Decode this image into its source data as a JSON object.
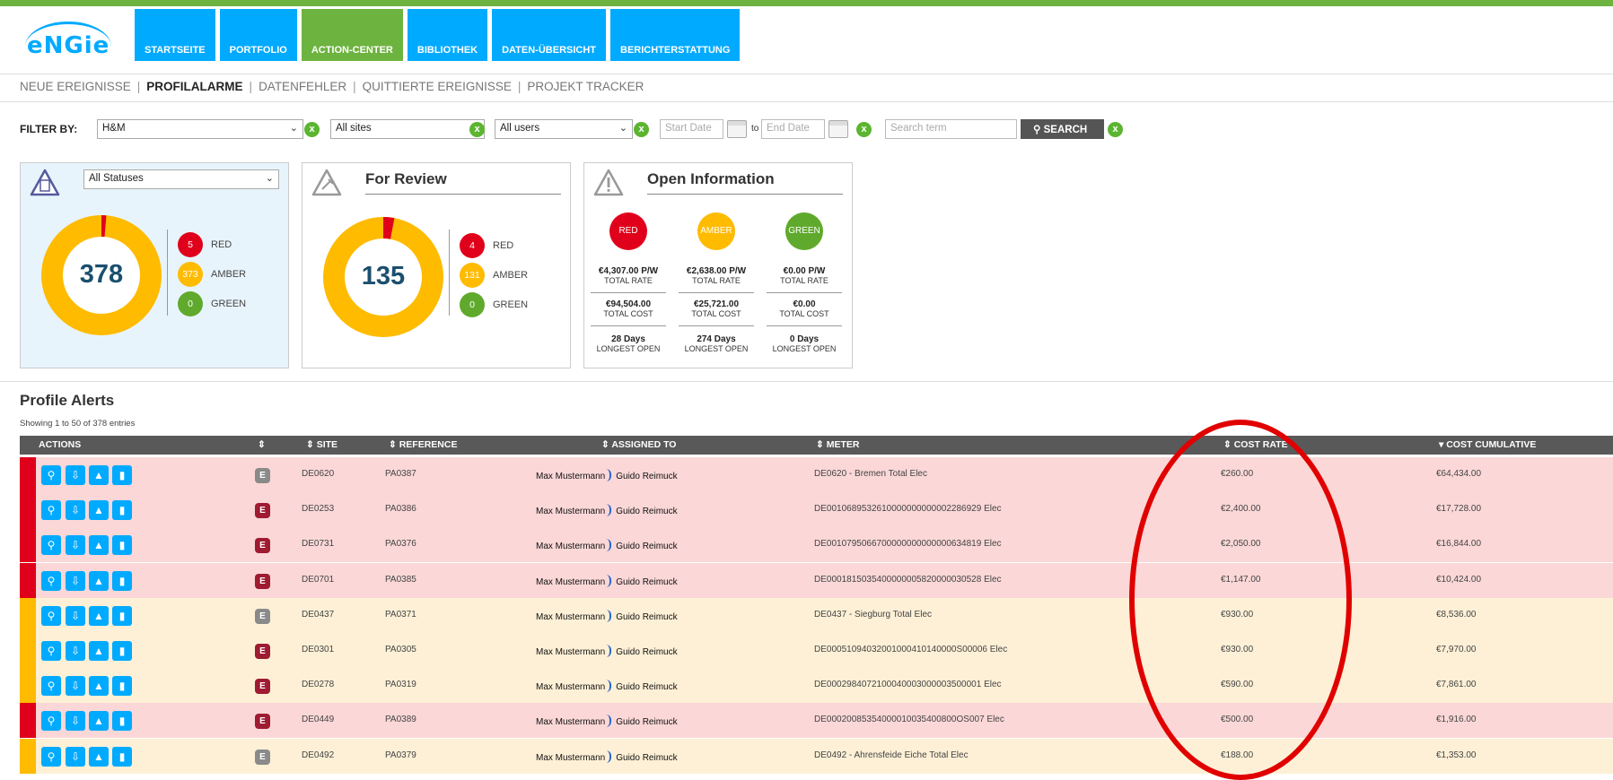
{
  "brand": {
    "logo_text": "eNGie",
    "accent": "#00aaff",
    "green": "#6db33f"
  },
  "nav": {
    "tabs": [
      {
        "label": "STARTSEITE",
        "active": false
      },
      {
        "label": "PORTFOLIO",
        "active": false
      },
      {
        "label": "ACTION-CENTER",
        "active": true
      },
      {
        "label": "BIBLIOTHEK",
        "active": false
      },
      {
        "label": "DATEN-ÜBERSICHT",
        "active": false
      },
      {
        "label": "BERICHTERSTATTUNG",
        "active": false
      }
    ]
  },
  "subnav": {
    "items": [
      {
        "label": "NEUE EREIGNISSE",
        "active": false
      },
      {
        "label": "PROFILALARME",
        "active": true
      },
      {
        "label": "DATENFEHLER",
        "active": false
      },
      {
        "label": "QUITTIERTE EREIGNISSE",
        "active": false
      },
      {
        "label": "PROJEKT TRACKER",
        "active": false
      }
    ]
  },
  "filter": {
    "label": "FILTER BY:",
    "client": "H&M",
    "sites": "All sites",
    "users": "All users",
    "start_placeholder": "Start Date",
    "to_label": "to",
    "end_placeholder": "End Date",
    "search_placeholder": "Search term",
    "search_button": "SEARCH",
    "clear_label": "x"
  },
  "cards": {
    "status": {
      "select": "All Statuses",
      "total": "378",
      "legend": [
        {
          "count": "5",
          "label": "RED",
          "color": "#e0001b"
        },
        {
          "count": "373",
          "label": "AMBER",
          "color": "#ffbb00"
        },
        {
          "count": "0",
          "label": "GREEN",
          "color": "#5faa2c"
        }
      ]
    },
    "review": {
      "title": "For Review",
      "total": "135",
      "legend": [
        {
          "count": "4",
          "label": "RED",
          "color": "#e0001b"
        },
        {
          "count": "131",
          "label": "AMBER",
          "color": "#ffbb00"
        },
        {
          "count": "0",
          "label": "GREEN",
          "color": "#5faa2c"
        }
      ]
    },
    "open": {
      "title": "Open Information",
      "columns": [
        {
          "label": "RED",
          "color": "#e0001b",
          "rate": "€4,307.00 P/W",
          "rate_lbl": "TOTAL RATE",
          "cost": "€94,504.00",
          "cost_lbl": "TOTAL COST",
          "days": "28 Days",
          "days_lbl": "LONGEST OPEN"
        },
        {
          "label": "AMBER",
          "color": "#ffbb00",
          "rate": "€2,638.00 P/W",
          "rate_lbl": "TOTAL RATE",
          "cost": "€25,721.00",
          "cost_lbl": "TOTAL COST",
          "days": "274 Days",
          "days_lbl": "LONGEST OPEN"
        },
        {
          "label": "GREEN",
          "color": "#5faa2c",
          "rate": "€0.00 P/W",
          "rate_lbl": "TOTAL RATE",
          "cost": "€0.00",
          "cost_lbl": "TOTAL COST",
          "days": "0 Days",
          "days_lbl": "LONGEST OPEN"
        }
      ]
    }
  },
  "table": {
    "title": "Profile Alerts",
    "showing": "Showing 1 to 50 of 378 entries",
    "headers": {
      "actions": "ACTIONS",
      "type": "⇕",
      "site": "⇕ SITE",
      "reference": "⇕ REFERENCE",
      "assigned": "⇕ ASSIGNED TO",
      "meter": "⇕ METER",
      "cost_rate": "⇕ COST RATE",
      "cost_cumulative": "▾ COST CUMULATIVE"
    },
    "rows": [
      {
        "status": "red",
        "icon": "E",
        "icon_style": "grey",
        "site": "DE0620",
        "ref": "PA0387",
        "from": "Max Mustermann",
        "to": "Guido Reimuck",
        "meter": "DE0620 - Bremen Total Elec",
        "rate": "€260.00",
        "cum": "€64,434.00"
      },
      {
        "status": "red",
        "icon": "E",
        "icon_style": "red",
        "site": "DE0253",
        "ref": "PA0386",
        "from": "Max Mustermann",
        "to": "Guido Reimuck",
        "meter": "DE0010689532610000000000002286929 Elec",
        "rate": "€2,400.00",
        "cum": "€17,728.00"
      },
      {
        "status": "red",
        "icon": "E",
        "icon_style": "red",
        "site": "DE0731",
        "ref": "PA0376",
        "from": "Max Mustermann",
        "to": "Guido Reimuck",
        "meter": "DE0010795066700000000000000634819 Elec",
        "rate": "€2,050.00",
        "cum": "€16,844.00"
      },
      {
        "status": "red",
        "icon": "E",
        "icon_style": "red",
        "site": "DE0701",
        "ref": "PA0385",
        "from": "Max Mustermann",
        "to": "Guido Reimuck",
        "meter": "DE0001815035400000005820000030528 Elec",
        "rate": "€1,147.00",
        "cum": "€10,424.00"
      },
      {
        "status": "amber",
        "icon": "E",
        "icon_style": "grey",
        "site": "DE0437",
        "ref": "PA0371",
        "from": "Max Mustermann",
        "to": "Guido Reimuck",
        "meter": "DE0437 - Siegburg Total Elec",
        "rate": "€930.00",
        "cum": "€8,536.00"
      },
      {
        "status": "amber",
        "icon": "E",
        "icon_style": "red",
        "site": "DE0301",
        "ref": "PA0305",
        "from": "Max Mustermann",
        "to": "Guido Reimuck",
        "meter": "DE00051094032001000410140000S00006 Elec",
        "rate": "€930.00",
        "cum": "€7,970.00"
      },
      {
        "status": "amber",
        "icon": "E",
        "icon_style": "red",
        "site": "DE0278",
        "ref": "PA0319",
        "from": "Max Mustermann",
        "to": "Guido Reimuck",
        "meter": "DE0002984072100040003000003500001 Elec",
        "rate": "€590.00",
        "cum": "€7,861.00"
      },
      {
        "status": "red",
        "icon": "E",
        "icon_style": "red",
        "site": "DE0449",
        "ref": "PA0389",
        "from": "Max Mustermann",
        "to": "Guido Reimuck",
        "meter": "DE00020085354000010035400800OS007 Elec",
        "rate": "€500.00",
        "cum": "€1,916.00"
      },
      {
        "status": "amber",
        "icon": "E",
        "icon_style": "grey",
        "site": "DE0492",
        "ref": "PA0379",
        "from": "Max Mustermann",
        "to": "Guido Reimuck",
        "meter": "DE0492 - Ahrensfeide Eiche Total Elec",
        "rate": "€188.00",
        "cum": "€1,353.00"
      }
    ],
    "colors": {
      "red_row": "#fbd7d7",
      "amber_row": "#fdf0d6",
      "red_strip": "#e0001b",
      "amber_strip": "#ffbb00"
    }
  }
}
